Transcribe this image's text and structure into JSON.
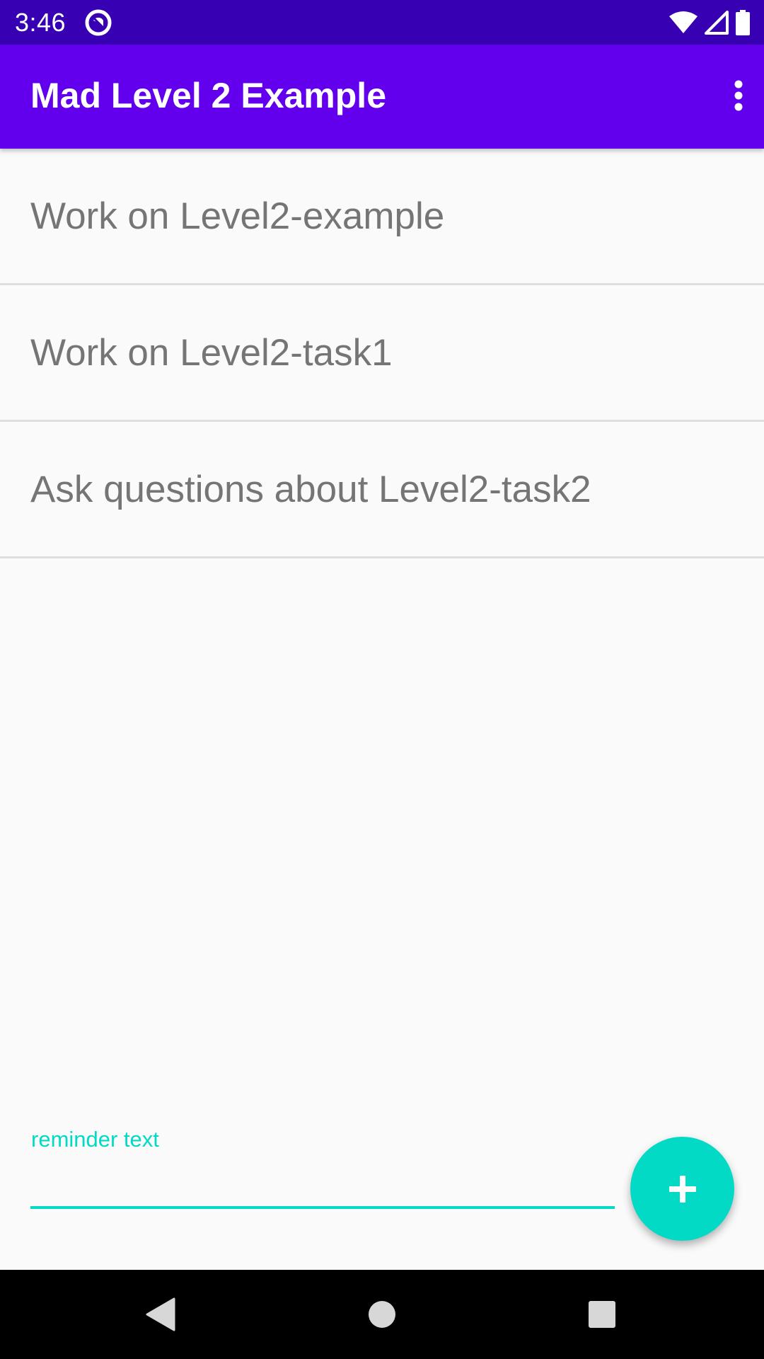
{
  "status_bar": {
    "time": "3:46",
    "icons": [
      "app-notification-icon",
      "wifi-icon",
      "cell-signal-icon",
      "battery-icon"
    ]
  },
  "app_bar": {
    "title": "Mad Level 2 Example",
    "menu_icon": "more-vert-icon"
  },
  "reminders": [
    {
      "text": "Work on Level2-example"
    },
    {
      "text": "Work on Level2-task1"
    },
    {
      "text": "Ask questions about Level2-task2"
    }
  ],
  "input": {
    "label": "reminder text",
    "value": ""
  },
  "fab": {
    "icon": "add-icon"
  },
  "nav_bar": {
    "icons": [
      "back-icon",
      "home-icon",
      "recents-icon"
    ]
  },
  "colors": {
    "status_bar": "#3700b3",
    "primary": "#6200ee",
    "accent": "#03dac5",
    "background": "#fafafa",
    "item_text": "#757575",
    "divider": "#dedede"
  }
}
